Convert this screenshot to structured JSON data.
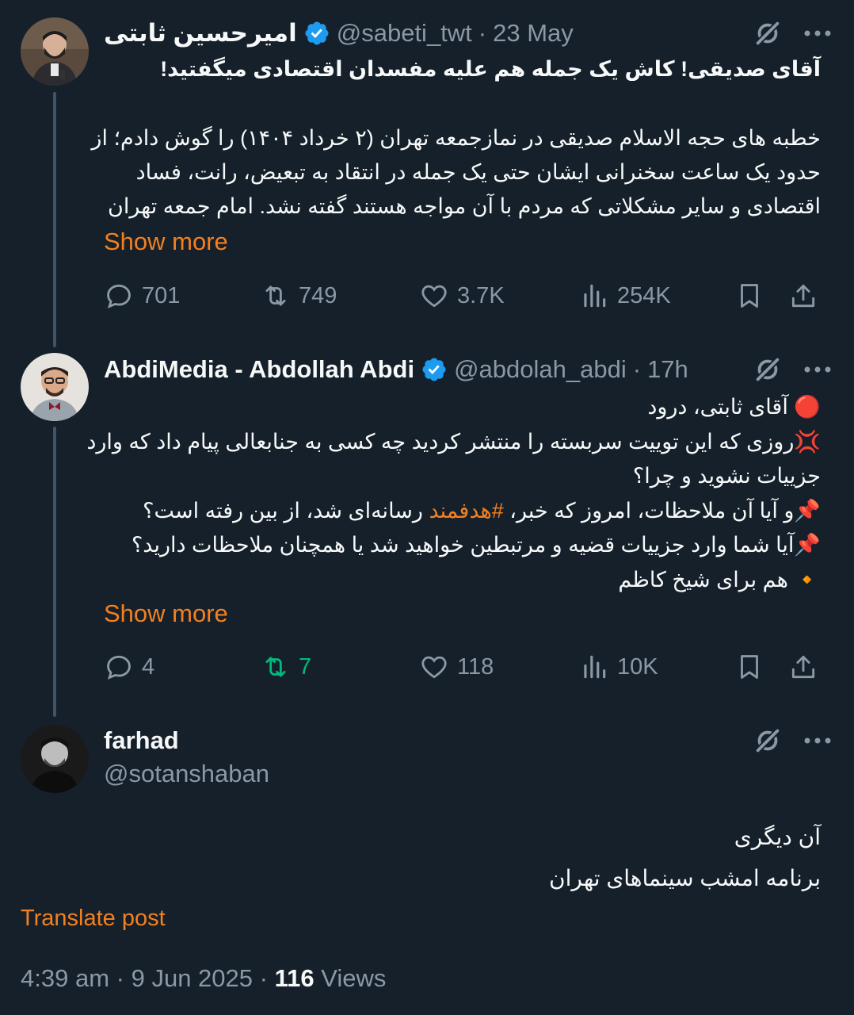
{
  "tweets": [
    {
      "name": "امیرحسین ثابتی",
      "handle": "@sabeti_twt",
      "sep": "·",
      "time": "23 May",
      "lines": [
        "آقای صدیقی! کاش یک جمله هم علیه مفسدان اقتصادی میگفتید!",
        "خطبه های حجه الاسلام صدیقی در نمازجمعه تهران (۲ خرداد ۱۴۰۴) را گوش دادم؛ از",
        "حدود یک ساعت سخنرانی ایشان حتی یک جمله در انتقاد به تبعیض، رانت، فساد",
        "اقتصادی و سایر مشکلاتی که مردم با آن مواجه هستند گفته نشد. امام جمعه تهران"
      ],
      "show_more": "Show more",
      "stats": {
        "replies": "701",
        "reposts": "749",
        "likes": "3.7K",
        "views": "254K"
      }
    },
    {
      "name": "AbdiMedia - Abdollah Abdi",
      "handle": "@abdolah_abdi",
      "sep": "·",
      "time": "17h",
      "lines": [
        "آقای ثابتی، درود",
        "روزی که این توییت سربسته را منتشر کردید چه کسی به جنابعالی پیام داد که وارد",
        "جزییات نشوید و چرا؟",
        "و آیا آن ملاحظات، امروز که خبر،",
        "رسانه‌ای شد، از بین رفته است؟",
        "آیا شما وارد جزییات قضیه و مرتبطین خواهید شد یا همچنان ملاحظات دارید؟",
        "هم برای شیخ کاظم"
      ],
      "hashtag": "#هدفمند",
      "show_more": "Show more",
      "stats": {
        "replies": "4",
        "reposts": "7",
        "likes": "118",
        "views": "10K"
      }
    },
    {
      "name": "farhad",
      "handle": "@sotanshaban",
      "lines": [
        "آن دیگری",
        "برنامه امشب سینماهای تهران"
      ],
      "translate": "Translate post",
      "footer": {
        "time": "4:39 am",
        "sep": "·",
        "date": "9 Jun 2025",
        "views_count": "116",
        "views_label": "Views"
      }
    }
  ],
  "emojis": {
    "red_circle": "🔴",
    "anger": "💢",
    "pin": "📌",
    "diamond": "🔸"
  },
  "colors": {
    "background": "#15202b",
    "accent": "#f4801f",
    "verified": "#1d9bf0",
    "muted": "#8b98a5",
    "retweet_active": "#00ba7c"
  },
  "icons": [
    "verified-badge-icon",
    "grok-icon",
    "more-icon",
    "reply-icon",
    "repost-icon",
    "like-icon",
    "views-icon",
    "bookmark-icon",
    "share-icon"
  ]
}
